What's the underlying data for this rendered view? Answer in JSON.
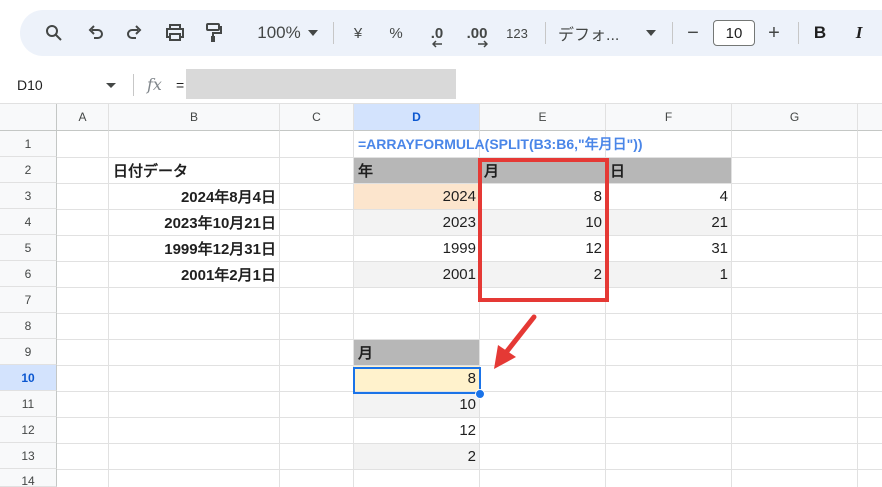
{
  "toolbar": {
    "zoom": "100%",
    "currency": "¥",
    "percent": "%",
    "decrease_decimal": ".0",
    "increase_decimal": ".00",
    "number_format": "123",
    "font": "デフォ...",
    "font_size_minus": "−",
    "font_size": "10",
    "font_size_plus": "+",
    "bold": "B",
    "italic": "I"
  },
  "formula_bar": {
    "name_box": "D10",
    "fx": "fx",
    "equals": "="
  },
  "columns": [
    "A",
    "B",
    "C",
    "D",
    "E",
    "F",
    "G"
  ],
  "rows": [
    "1",
    "2",
    "3",
    "4",
    "5",
    "6",
    "7",
    "8",
    "9",
    "10",
    "11",
    "12",
    "13",
    "14"
  ],
  "cells": {
    "D1": "=ARRAYFORMULA(SPLIT(B3:B6,\"年月日\"))",
    "B2": "日付データ",
    "B3": "2024年8月4日",
    "B4": "2023年10月21日",
    "B5": "1999年12月31日",
    "B6": "2001年2月1日",
    "D2": "年",
    "E2": "月",
    "F2": "日",
    "D3": "2024",
    "E3": "8",
    "F3": "4",
    "D4": "2023",
    "E4": "10",
    "F4": "21",
    "D5": "1999",
    "E5": "12",
    "F5": "31",
    "D6": "2001",
    "E6": "2",
    "F6": "1",
    "D9": "月",
    "D10": "8",
    "D11": "10",
    "D12": "12",
    "D13": "2"
  },
  "colors": {
    "toolbar_bg": "#edf2fa",
    "selection": "#1a73e8",
    "header_gray": "#b7b7b7",
    "peach": "#fce5cd",
    "yellow": "#fff2cc",
    "formula_blue": "#4a86e8",
    "annotation_red": "#e53935"
  }
}
